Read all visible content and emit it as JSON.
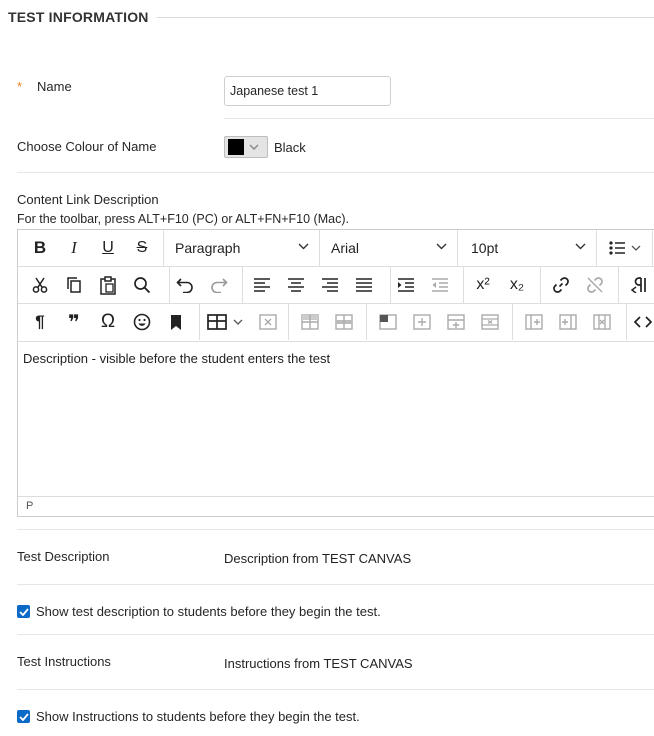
{
  "section": {
    "title": "TEST INFORMATION"
  },
  "name_field": {
    "required_marker": "*",
    "label": "Name",
    "value": "Japanese test 1"
  },
  "colour_field": {
    "label": "Choose Colour of Name",
    "swatch_color": "#000000",
    "value": "Black"
  },
  "content_link": {
    "label": "Content Link Description",
    "hint": "For the toolbar, press ALT+F10 (PC) or ALT+FN+F10 (Mac).",
    "toolbar": {
      "block_format": "Paragraph",
      "font_family": "Arial",
      "font_size": "10pt",
      "bold_label": "B",
      "italic_label": "I",
      "underline_label": "U",
      "strike_label": "S",
      "superscript_label": "x²",
      "subscript_label": "x₂",
      "pilcrow_label": "¶",
      "omega_label": "Ω",
      "quote_label": "❞"
    },
    "content": "Description - visible before the student enters the test",
    "status_path": "P"
  },
  "test_description": {
    "label": "Test Description",
    "value": "Description from TEST CANVAS",
    "checkbox_label": "Show test description to students before they begin the test.",
    "checked": true
  },
  "test_instructions": {
    "label": "Test Instructions",
    "value": "Instructions from TEST CANVAS",
    "checkbox_label": "Show Instructions to students before they begin the test.",
    "checked": true
  },
  "colors": {
    "required": "#e6821e",
    "checkbox": "#0b69c7"
  }
}
